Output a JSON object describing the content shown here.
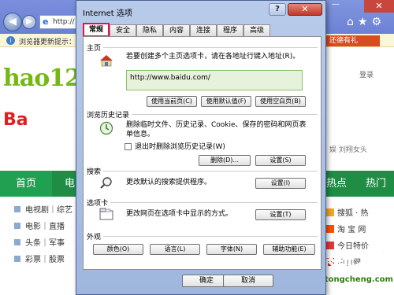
{
  "browser": {
    "address_text": "http://",
    "infobar_text": "浏览器更新提示：",
    "right_button": "还德有礼",
    "logo_text": "hao12",
    "logo2_text": "Ba",
    "login": "登录",
    "right_text": "娱   刘翔女头",
    "nav": {
      "home": "首页",
      "item2": "电",
      "hot": "热点",
      "hot2": "热门"
    },
    "left_list": [
      "电视剧｜综艺",
      "电影｜直播",
      "头条｜军事",
      "彩票｜股票"
    ],
    "right_list": [
      "搜狐 · 热",
      "淘 宝 网",
      "今日特价",
      "凤凰网"
    ]
  },
  "watermark": {
    "brand": "系统之家",
    "url": "xitongcheng.com"
  },
  "dialog": {
    "title": "Internet 选项",
    "help": "?",
    "close": "✕",
    "tabs": [
      "常规",
      "安全",
      "隐私",
      "内容",
      "连接",
      "程序",
      "高级"
    ],
    "home": {
      "section": "主页",
      "desc": "若要创建多个主页选项卡，请在各地址行键入地址(R)。",
      "url": "http://www.baidu.com/",
      "buttons": [
        "使用当前页(C)",
        "使用默认值(F)",
        "使用空白页(B)"
      ]
    },
    "history": {
      "section": "浏览历史记录",
      "desc": "删除临时文件、历史记录、Cookie、保存的密码和网页表单信息。",
      "checkbox": "退出时删除浏览历史记录(W)",
      "delete": "删除(D)...",
      "settings": "设置(S)"
    },
    "search": {
      "section": "搜索",
      "desc": "更改默认的搜索提供程序。",
      "settings": "设置(I)"
    },
    "tabs_sec": {
      "section": "选项卡",
      "desc": "更改网页在选项卡中显示的方式。",
      "settings": "设置(T)"
    },
    "appearance": {
      "section": "外观",
      "buttons": [
        "颜色(O)",
        "语言(L)",
        "字体(N)",
        "辅助功能(E)"
      ]
    },
    "footer": {
      "ok": "确定",
      "cancel": "取消"
    }
  },
  "colors": {
    "tab_highlight": "#e0144c",
    "nav_green": "#1f8d44",
    "title_bar": "#b9cbea"
  }
}
